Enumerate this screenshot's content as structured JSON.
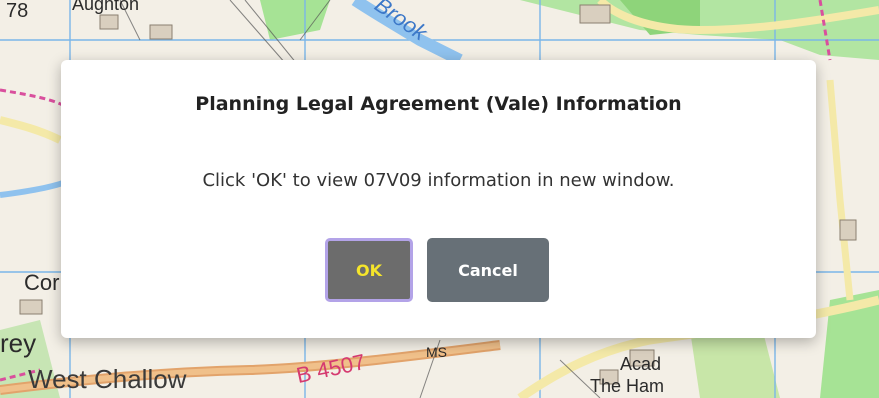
{
  "map": {
    "labels": {
      "top_left_number": "78",
      "top_place": "Aughton",
      "water": "Brook",
      "left_partial_cor": "Cor",
      "left_partial_rey": "rey",
      "west_challow": "West Challow",
      "road_number": "B 4507",
      "ms": "MS",
      "acad": "Acad",
      "the_ham": "The Ham"
    },
    "colors": {
      "land": "#f3efe6",
      "woodland": "#a6e395",
      "road_major": "#e2a36b",
      "road_minor": "#f4e9a8",
      "grid": "#7ab6e8",
      "water": "#8fc2ee",
      "boundary": "#d94f9d"
    }
  },
  "dialog": {
    "title": "Planning Legal Agreement (Vale) Information",
    "message": "Click 'OK' to view 07V09 information in new window.",
    "ok_label": "OK",
    "cancel_label": "Cancel"
  }
}
